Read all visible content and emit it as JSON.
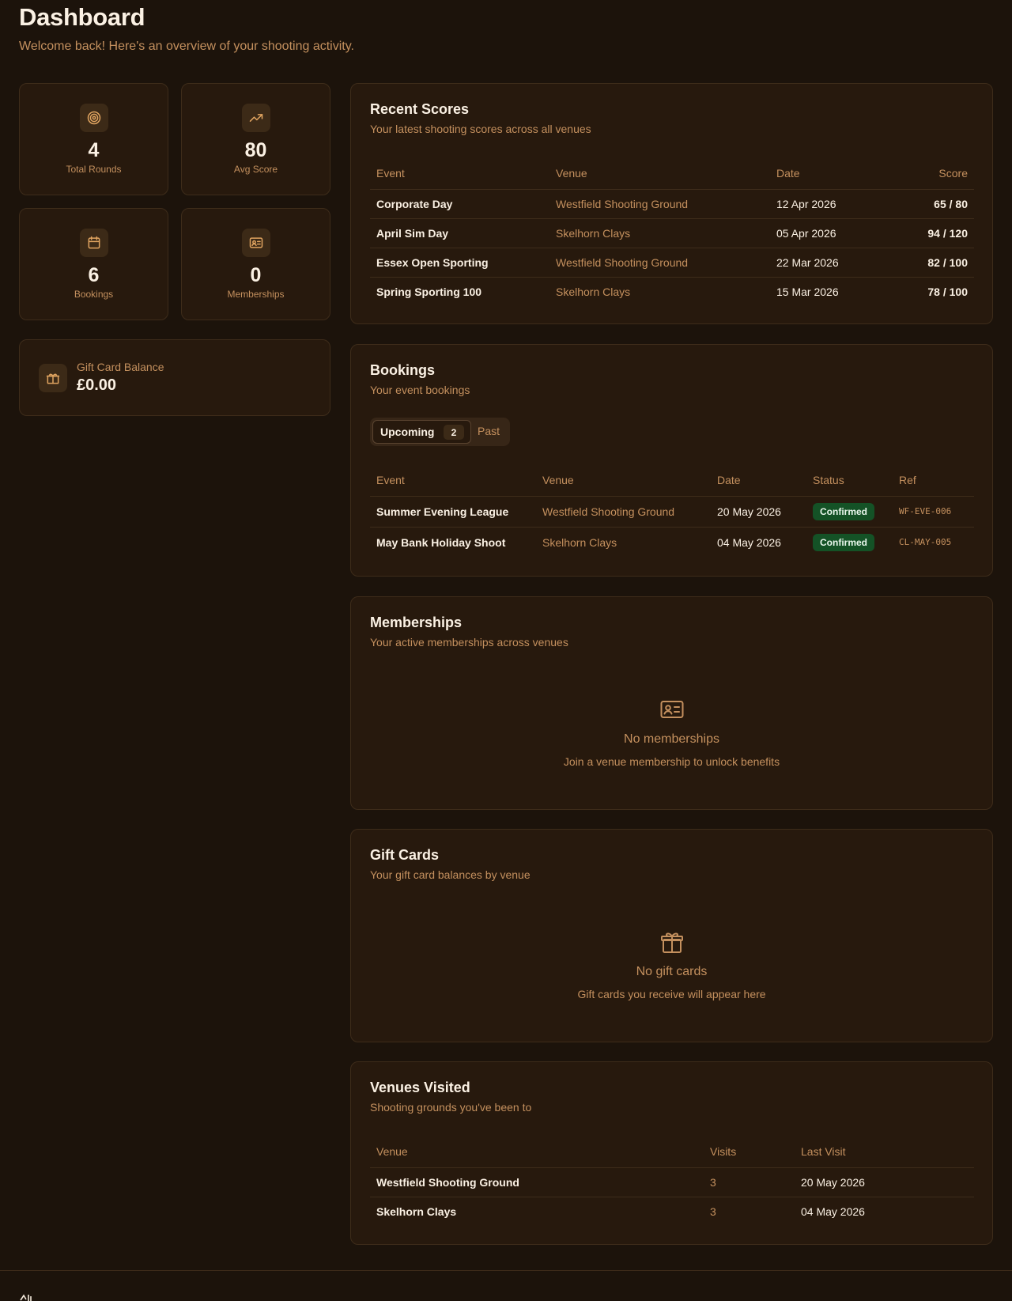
{
  "header": {
    "title": "Dashboard",
    "subtitle": "Welcome back! Here's an overview of your shooting activity."
  },
  "stats": [
    {
      "icon": "target-icon",
      "value": "4",
      "label": "Total Rounds"
    },
    {
      "icon": "trending-up-icon",
      "value": "80",
      "label": "Avg Score"
    },
    {
      "icon": "calendar-icon",
      "value": "6",
      "label": "Bookings"
    },
    {
      "icon": "id-card-icon",
      "value": "0",
      "label": "Memberships"
    }
  ],
  "gift_balance": {
    "icon": "gift-icon",
    "label": "Gift Card Balance",
    "value": "£0.00"
  },
  "recent_scores": {
    "title": "Recent Scores",
    "subtitle": "Your latest shooting scores across all venues",
    "columns": [
      "Event",
      "Venue",
      "Date",
      "Score"
    ],
    "rows": [
      {
        "event": "Corporate Day",
        "venue": "Westfield Shooting Ground",
        "date": "12 Apr 2026",
        "score": "65 / 80"
      },
      {
        "event": "April Sim Day",
        "venue": "Skelhorn Clays",
        "date": "05 Apr 2026",
        "score": "94 / 120"
      },
      {
        "event": "Essex Open Sporting",
        "venue": "Westfield Shooting Ground",
        "date": "22 Mar 2026",
        "score": "82 / 100"
      },
      {
        "event": "Spring Sporting 100",
        "venue": "Skelhorn Clays",
        "date": "15 Mar 2026",
        "score": "78 / 100"
      }
    ]
  },
  "bookings": {
    "title": "Bookings",
    "subtitle": "Your event bookings",
    "tabs": {
      "upcoming": "Upcoming",
      "upcoming_count": "2",
      "past": "Past"
    },
    "columns": [
      "Event",
      "Venue",
      "Date",
      "Status",
      "Ref"
    ],
    "rows": [
      {
        "event": "Summer Evening League",
        "venue": "Westfield Shooting Ground",
        "date": "20 May 2026",
        "status": "Confirmed",
        "ref": "WF-EVE-006"
      },
      {
        "event": "May Bank Holiday Shoot",
        "venue": "Skelhorn Clays",
        "date": "04 May 2026",
        "status": "Confirmed",
        "ref": "CL-MAY-005"
      }
    ]
  },
  "memberships": {
    "title": "Memberships",
    "subtitle": "Your active memberships across venues",
    "empty_icon": "id-card-icon",
    "empty_title": "No memberships",
    "empty_subtitle": "Join a venue membership to unlock benefits"
  },
  "gift_cards": {
    "title": "Gift Cards",
    "subtitle": "Your gift card balances by venue",
    "empty_icon": "gift-icon",
    "empty_title": "No gift cards",
    "empty_subtitle": "Gift cards you receive will appear here"
  },
  "venues": {
    "title": "Venues Visited",
    "subtitle": "Shooting grounds you've been to",
    "columns": [
      "Venue",
      "Visits",
      "Last Visit"
    ],
    "rows": [
      {
        "venue": "Westfield Shooting Ground",
        "visits": "3",
        "last_visit": "20 May 2026"
      },
      {
        "venue": "Skelhorn Clays",
        "visits": "3",
        "last_visit": "04 May 2026"
      }
    ]
  },
  "colors": {
    "background": "#1c130b",
    "card": "#27190d",
    "border": "#3e2c1a",
    "accent_text": "#c4905e",
    "icon": "#e0a460",
    "badge_confirmed": "#145226"
  }
}
